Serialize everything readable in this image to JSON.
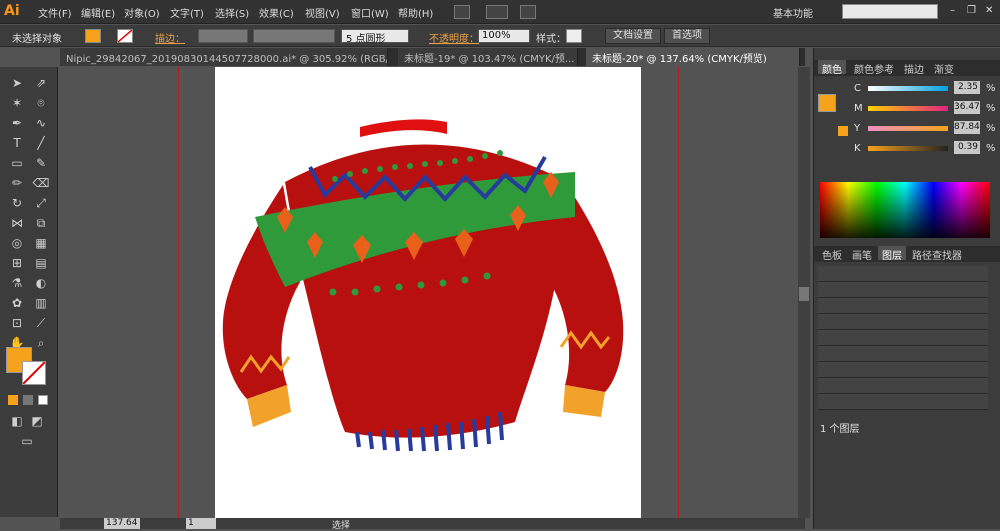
{
  "app": {
    "logo": "Ai"
  },
  "menu": [
    "文件(F)",
    "编辑(E)",
    "对象(O)",
    "文字(T)",
    "选择(S)",
    "效果(C)",
    "视图(V)",
    "窗口(W)",
    "帮助(H)"
  ],
  "workspace": "基本功能",
  "control": {
    "selection": "未选择对象",
    "stroke_label": "描边：",
    "brush": "5 点圆形",
    "opacity_label": "不透明度：",
    "opacity": "100%",
    "style_label": "样式：",
    "doc_setup": "文档设置",
    "prefs": "首选项",
    "fill_color": "#f7a21b"
  },
  "tabs": [
    "Nipic_29842067_20190830144507728000.ai* @ 305.92% (RGB/预...",
    "未标题-19* @ 103.47% (CMYK/预...",
    "未标题-20* @ 137.64% (CMYK/预览)"
  ],
  "color_panel": {
    "tabs": [
      "颜色",
      "颜色参考",
      "描边",
      "渐变"
    ],
    "channels": [
      {
        "k": "C",
        "v": "2.35"
      },
      {
        "k": "M",
        "v": "36.47"
      },
      {
        "k": "Y",
        "v": "87.84"
      },
      {
        "k": "K",
        "v": "0.39"
      }
    ],
    "unit": "%"
  },
  "layers_panel": {
    "tabs": [
      "色板",
      "画笔",
      "图层",
      "路径查找器"
    ],
    "count": "1 个图层"
  },
  "status": {
    "zoom": "137.64",
    "page": "1",
    "tool": "选择"
  },
  "colors": {
    "accent": "#f7a21b",
    "sweater_red": "#b8100f",
    "green": "#2e9a3a",
    "blue": "#283a9b"
  }
}
